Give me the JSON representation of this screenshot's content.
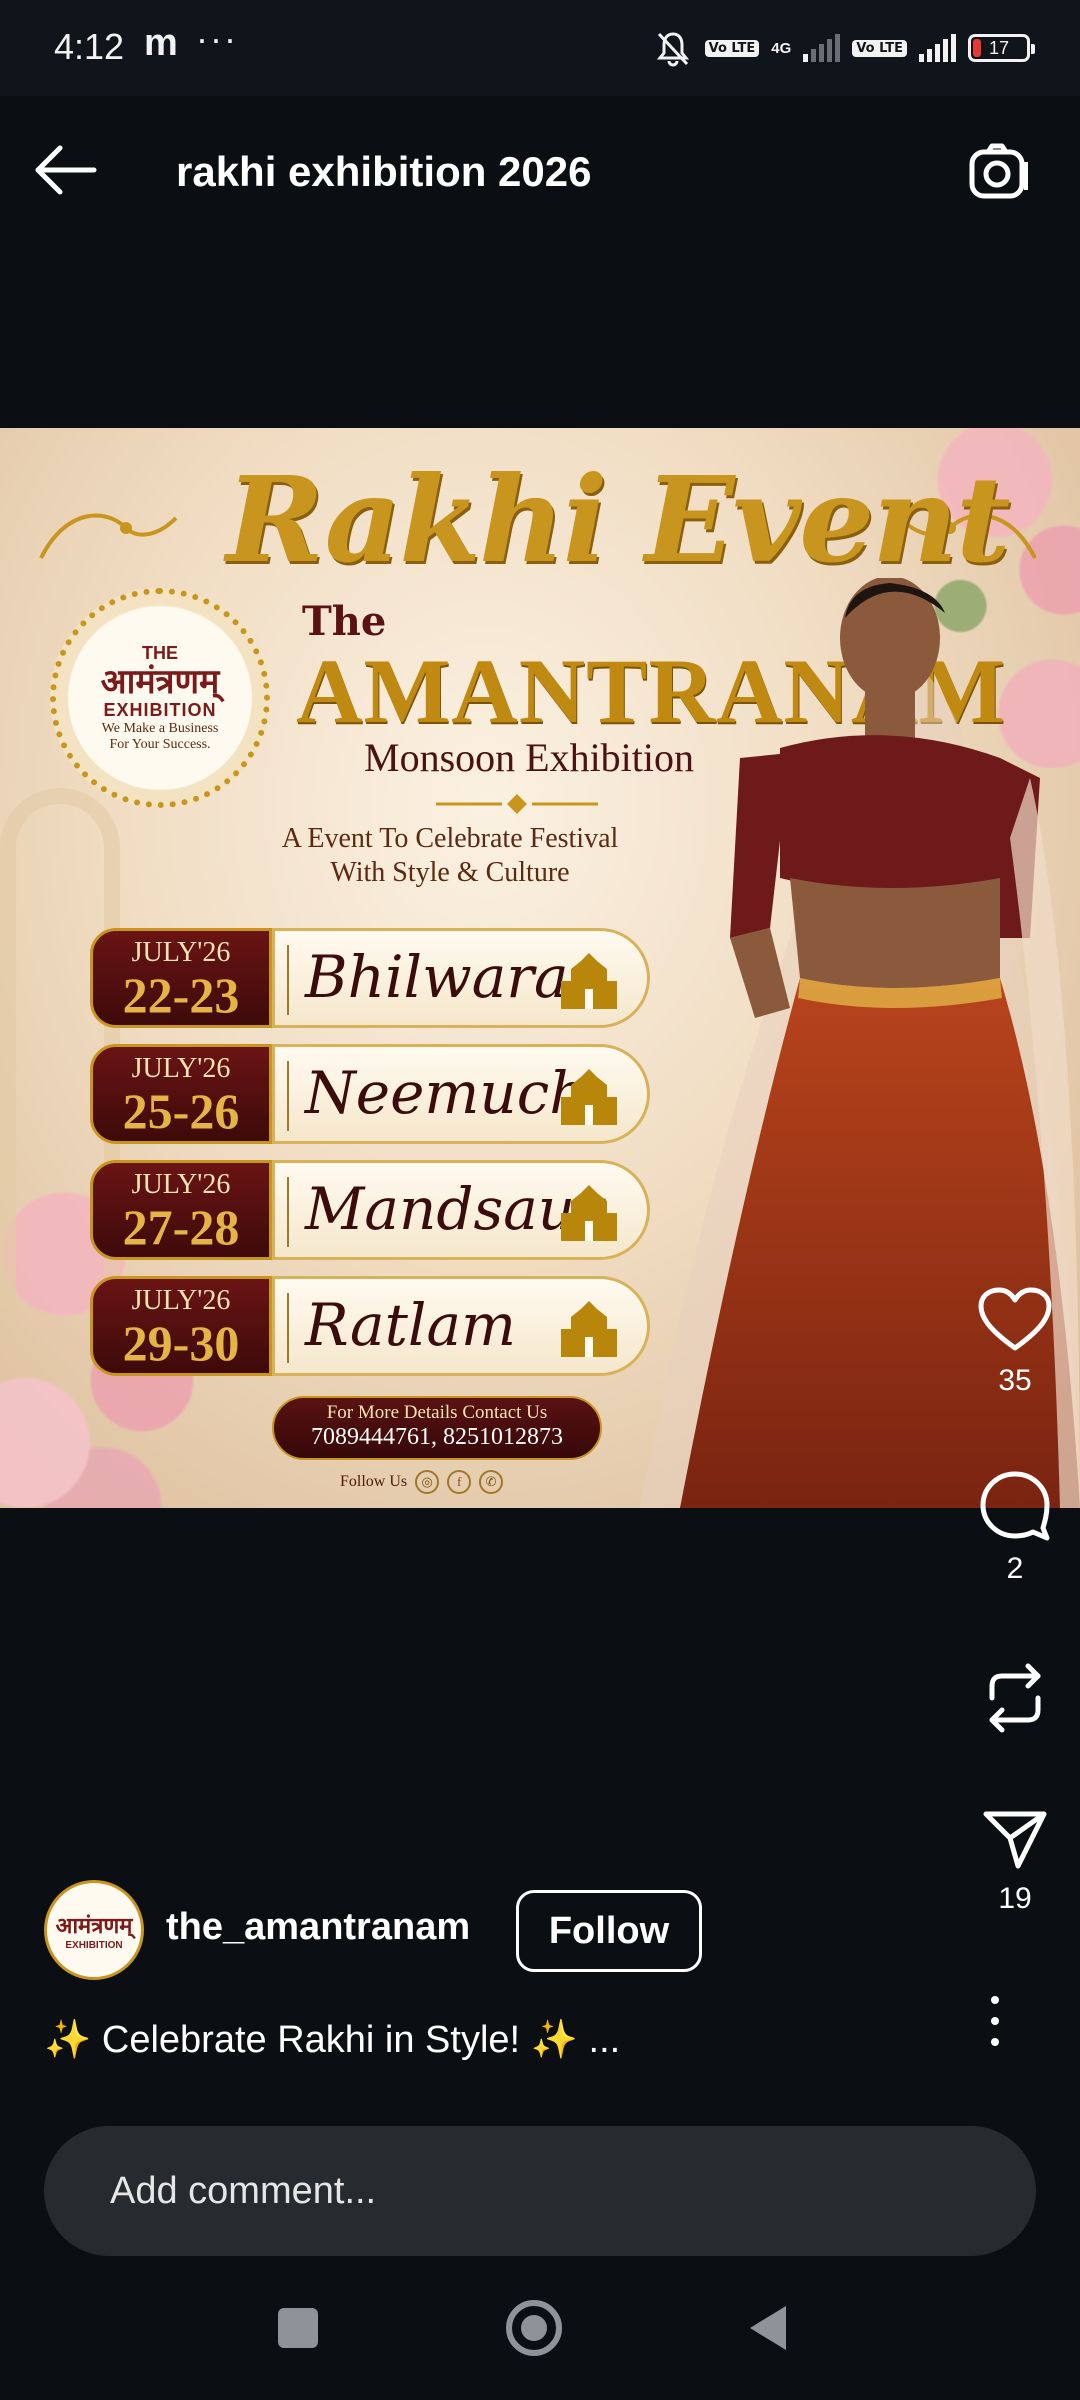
{
  "status_bar": {
    "time": "4:12",
    "app_letter": "m",
    "more": "···",
    "network": "4G",
    "volte": "Vo LTE",
    "battery": "17"
  },
  "header": {
    "title": "rakhi exhibition 2026",
    "back_icon": "arrow-left-icon",
    "camera_icon": "camera-icon"
  },
  "poster": {
    "script_title": "Rakhi Event",
    "the": "The",
    "name": "AMANTRANAM",
    "subtitle": "Monsoon Exhibition",
    "tagline_1": "A Event To Celebrate Festival",
    "tagline_2": "With Style & Culture",
    "seal": {
      "the": "THE",
      "hindi": "आमंत्रणम्",
      "exhibition": "EXHIBITION",
      "motto": "We Make a Business For Your Success."
    },
    "events": [
      {
        "month": "JULY'26",
        "days": "22-23",
        "city": "Bhilwara"
      },
      {
        "month": "JULY'26",
        "days": "25-26",
        "city": "Neemuch"
      },
      {
        "month": "JULY'26",
        "days": "27-28",
        "city": "Mandsaur"
      },
      {
        "month": "JULY'26",
        "days": "29-30",
        "city": "Ratlam"
      }
    ],
    "contact_label": "For More Details Contact Us",
    "contact_numbers": "7089444761, 8251012873",
    "follow_label": "Follow Us"
  },
  "actions": {
    "likes": "35",
    "comments": "2",
    "shares": "19"
  },
  "author": {
    "username": "the_amantranam",
    "follow_label": "Follow",
    "avatar_text": "आमंत्रणम्",
    "avatar_sub": "EXHIBITION"
  },
  "caption": {
    "sparkle": "✨",
    "text": " Celebrate Rakhi in Style! ",
    "more": " ..."
  },
  "comment": {
    "placeholder": "Add comment..."
  },
  "colors": {
    "background": "#0b0f14",
    "gold": "#c8961f",
    "maroon": "#5a1212",
    "comment_bg": "#272b30"
  }
}
